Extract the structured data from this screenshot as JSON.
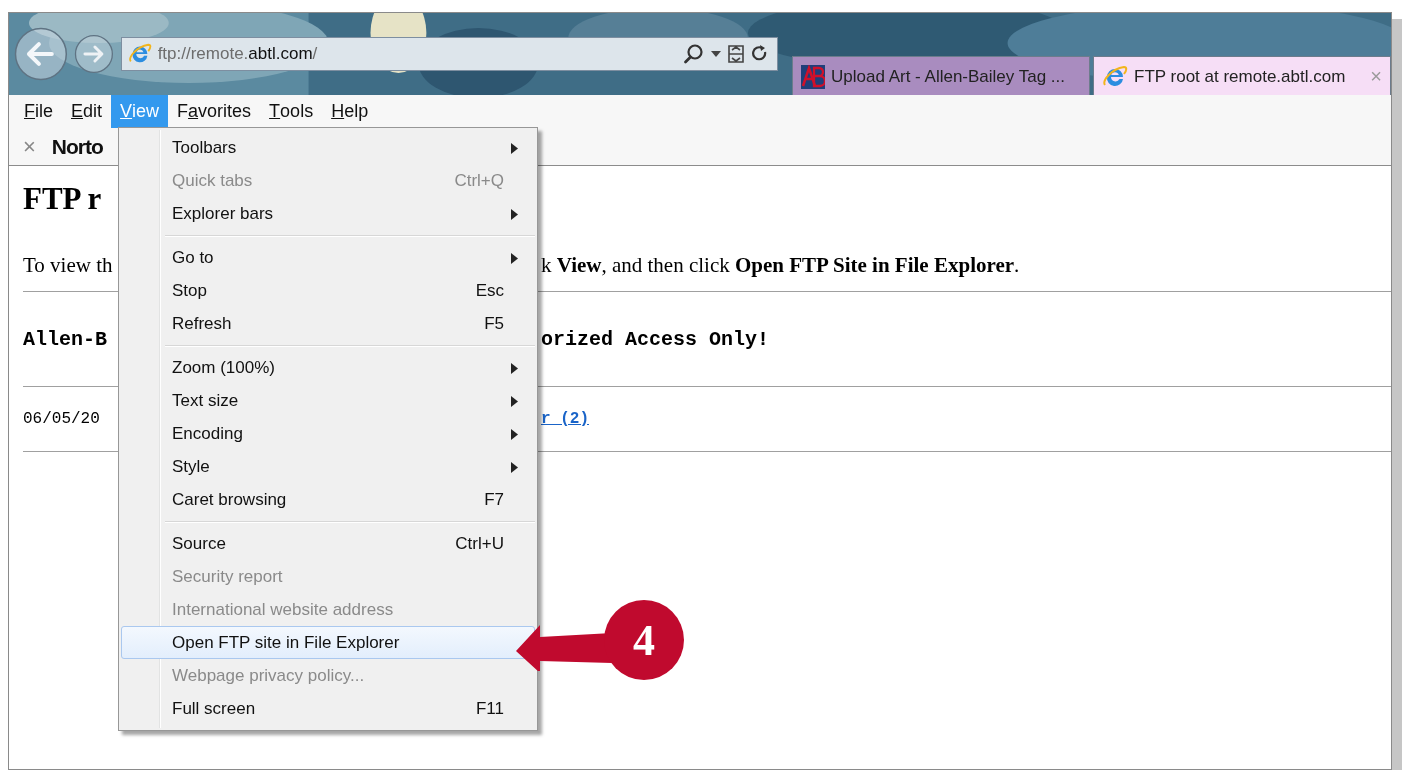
{
  "address_bar": {
    "prefix": "ftp://remote.",
    "domain": "abtl.com",
    "suffix": "/"
  },
  "tabs": [
    {
      "label": "Upload Art - Allen-Bailey Tag ...",
      "selected": false,
      "kind": "ab"
    },
    {
      "label": "FTP root at remote.abtl.com",
      "selected": true,
      "kind": "ie",
      "close": "×"
    }
  ],
  "menu_bar": [
    {
      "access_key": "F",
      "after": "ile",
      "selected": false
    },
    {
      "access_key": "E",
      "after": "dit",
      "selected": false
    },
    {
      "access_key": "V",
      "after": "iew",
      "selected": true
    },
    {
      "before": "F",
      "access_key": "a",
      "after": "vorites",
      "selected": false
    },
    {
      "access_key": "T",
      "after": "ools",
      "selected": false
    },
    {
      "access_key": "H",
      "after": "elp",
      "selected": false
    }
  ],
  "norton_bar": {
    "close": "×",
    "label": "Norto"
  },
  "page": {
    "heading": "FTP r",
    "intro_left": "To view th",
    "intro_right": "k **View**, and then click **Open FTP Site in File Explorer**.",
    "notice_left": "Allen-B",
    "notice_right": "orized Access Only!",
    "listing_date": "06/05/20",
    "listing_link": "r (2)"
  },
  "view_menu": [
    {
      "kind": "item",
      "label": "Toolbars",
      "submenu": true,
      "disabled": false,
      "selected": false
    },
    {
      "kind": "item",
      "label": "Quick tabs",
      "shortcut": "Ctrl+Q",
      "submenu": false,
      "disabled": true,
      "selected": false
    },
    {
      "kind": "item",
      "label": "Explorer bars",
      "submenu": true,
      "disabled": false,
      "selected": false
    },
    {
      "kind": "separator"
    },
    {
      "kind": "item",
      "label": "Go to",
      "submenu": true,
      "disabled": false,
      "selected": false
    },
    {
      "kind": "item",
      "label": "Stop",
      "shortcut": "Esc",
      "submenu": false,
      "disabled": false,
      "selected": false
    },
    {
      "kind": "item",
      "label": "Refresh",
      "shortcut": "F5",
      "submenu": false,
      "disabled": false,
      "selected": false
    },
    {
      "kind": "separator"
    },
    {
      "kind": "item",
      "label": "Zoom (100%)",
      "submenu": true,
      "disabled": false,
      "selected": false
    },
    {
      "kind": "item",
      "label": "Text size",
      "submenu": true,
      "disabled": false,
      "selected": false
    },
    {
      "kind": "item",
      "label": "Encoding",
      "submenu": true,
      "disabled": false,
      "selected": false
    },
    {
      "kind": "item",
      "label": "Style",
      "submenu": true,
      "disabled": false,
      "selected": false
    },
    {
      "kind": "item",
      "label": "Caret browsing",
      "shortcut": "F7",
      "submenu": false,
      "disabled": false,
      "selected": false
    },
    {
      "kind": "separator"
    },
    {
      "kind": "item",
      "label": "Source",
      "shortcut": "Ctrl+U",
      "submenu": false,
      "disabled": false,
      "selected": false
    },
    {
      "kind": "item",
      "label": "Security report",
      "submenu": false,
      "disabled": true,
      "selected": false
    },
    {
      "kind": "item",
      "label": "International website address",
      "submenu": false,
      "disabled": true,
      "selected": false
    },
    {
      "kind": "item",
      "label": "Open FTP site in File Explorer",
      "submenu": false,
      "disabled": false,
      "selected": true
    },
    {
      "kind": "item",
      "label": "Webpage privacy policy...",
      "submenu": false,
      "disabled": true,
      "selected": false
    },
    {
      "kind": "item",
      "label": "Full screen",
      "shortcut": "F11",
      "submenu": false,
      "disabled": false,
      "selected": false
    }
  ],
  "callout": {
    "number": "4"
  }
}
